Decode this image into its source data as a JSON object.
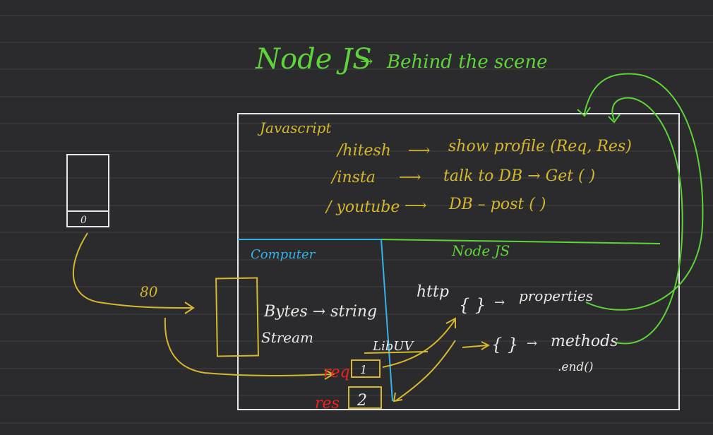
{
  "title": {
    "node": "Node JS",
    "rest": "Behind the scene"
  },
  "js_section": {
    "label": "Javascript",
    "routes": [
      {
        "path": "/hitesh",
        "target": "show profile (Req, Res)"
      },
      {
        "path": "/insta",
        "target": "talk to DB → Get ( )"
      },
      {
        "path": "/ youtube",
        "target": "DB – post ( )"
      }
    ]
  },
  "computer_label": "Computer",
  "node_label": "Node JS",
  "client": {
    "button": "0",
    "port": "80"
  },
  "stream": {
    "line1": "Bytes → string",
    "line2": "Stream"
  },
  "http": {
    "label": "http",
    "obj1": "{ }",
    "obj1_label": "properties",
    "obj2": "{ }",
    "obj2_label": "methods",
    "end": ".end()"
  },
  "libuv": "LibUV",
  "req": {
    "label": "req",
    "box": "1"
  },
  "res": {
    "label": "res",
    "box": "2"
  },
  "colors": {
    "green": "#5fd43a",
    "yellow": "#d4b82f",
    "white": "#e8e8e8",
    "blue": "#33b4e8",
    "red": "#ee2222",
    "bg": "#2b2b2d"
  }
}
